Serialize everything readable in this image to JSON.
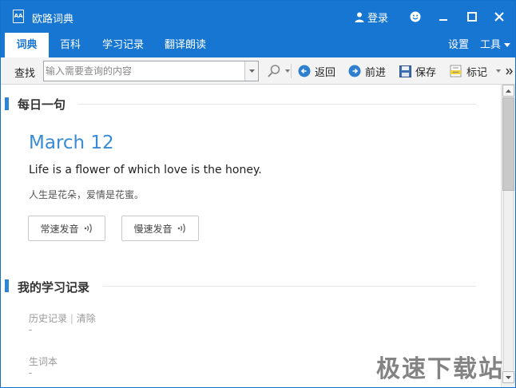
{
  "window": {
    "title": "欧路词典",
    "logo_text": "AA",
    "login_label": "登录"
  },
  "tabs": [
    {
      "label": "词典",
      "active": true
    },
    {
      "label": "百科",
      "active": false
    },
    {
      "label": "学习记录",
      "active": false
    },
    {
      "label": "翻译朗读",
      "active": false
    }
  ],
  "tabs_right": {
    "settings": "设置",
    "tools": "工具"
  },
  "toolbar": {
    "find_label": "查找",
    "search_placeholder": "输入需要查询的内容",
    "back": "返回",
    "forward": "前进",
    "save": "保存",
    "mark": "标记"
  },
  "daily": {
    "section_title": "每日一句",
    "date": "March 12",
    "sentence_en": "Life is a flower of which love is the honey.",
    "sentence_zh": "人生是花朵，爱情是花蜜。",
    "normal_speed": "常速发音",
    "slow_speed": "慢速发音"
  },
  "records": {
    "section_title": "我的学习记录",
    "history_label": "历史记录",
    "separator": "|",
    "clear_label": "清除",
    "history_value": "-",
    "vocab_label": "生词本",
    "vocab_value": "-"
  },
  "watermark": "极速下载站",
  "colors": {
    "brand_blue": "#1776d2",
    "accent_blue": "#3a8bd4"
  }
}
